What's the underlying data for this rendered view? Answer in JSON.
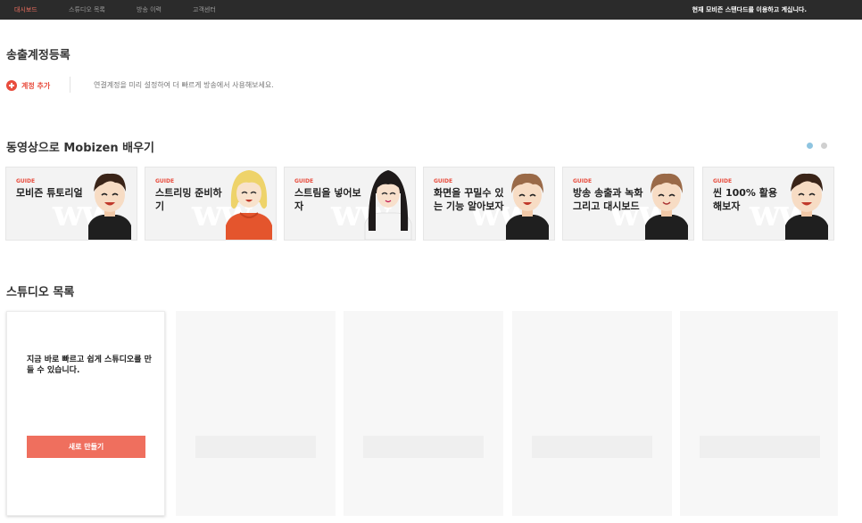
{
  "nav": {
    "items": [
      {
        "label": "대시보드",
        "active": true
      },
      {
        "label": "스튜디오 목록",
        "active": false
      },
      {
        "label": "방송 이력",
        "active": false
      },
      {
        "label": "고객센터",
        "active": false
      }
    ],
    "notice": "현재 모비즌 스탠다드를 이용하고 계십니다."
  },
  "account": {
    "title": "송출계정등록",
    "add_label": "계정 추가",
    "hint": "연결계정을 미리 설정하여 더 빠르게 방송에서 사용해보세요."
  },
  "guides": {
    "title": "동영상으로 Mobizen 배우기",
    "tag": "GUIDE",
    "watermark": "ww",
    "cards": [
      {
        "title": "모비즌 튜토리얼",
        "character": "boy-dark-hair"
      },
      {
        "title": "스트리밍 준비하기",
        "character": "girl-blonde-hoodie"
      },
      {
        "title": "스트림을 넣어보자",
        "character": "girl-long-black-hair"
      },
      {
        "title": "화면을 꾸밀수 있는 기능 알아보자",
        "character": "boy-brown-hair"
      },
      {
        "title": "방송 송출과 녹화 그리고 대시보드",
        "character": "boy-brown-hair"
      },
      {
        "title": "씬 100% 활용해보자",
        "character": "boy-dark-hair"
      }
    ],
    "pager": {
      "pages": 2,
      "current": 1
    }
  },
  "studios": {
    "title": "스튜디오 목록",
    "empty_message": "지금 바로 빠르고 쉽게 스튜디오를 만들 수 있습니다.",
    "create_label": "새로 만들기",
    "placeholders": 4
  },
  "colors": {
    "accent": "#e84c3d",
    "button": "#ef6f5e",
    "nav_bg": "#2b2b2b",
    "pager_active": "#8ec4e0"
  }
}
